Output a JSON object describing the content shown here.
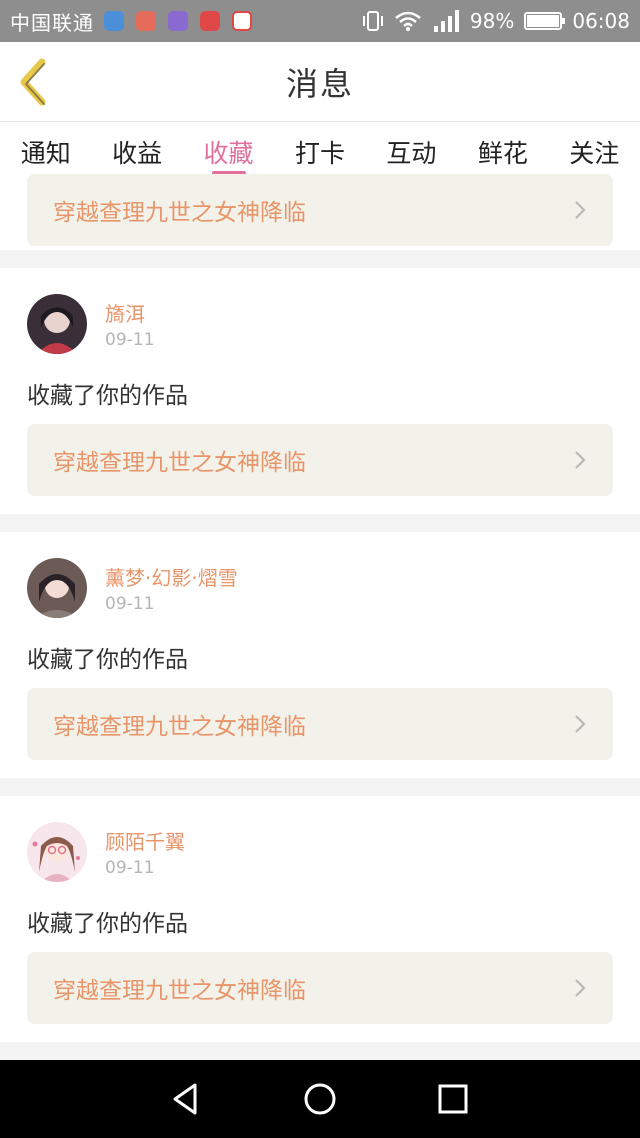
{
  "status_bar": {
    "carrier": "中国联通",
    "battery": "98%",
    "battery_level": 0.98,
    "time": "06:08",
    "app_icons": [
      {
        "name": "maps-icon",
        "color": "#4a8fd8"
      },
      {
        "name": "mail-icon",
        "color": "#e56b5a"
      },
      {
        "name": "gallery-icon",
        "color": "#8a6ad0"
      },
      {
        "name": "cloud-icon",
        "color": "#e04848"
      },
      {
        "name": "video-icon",
        "color": "#ffffff"
      }
    ]
  },
  "header": {
    "title": "消息"
  },
  "tabs": [
    {
      "label": "通知",
      "active": false
    },
    {
      "label": "收益",
      "active": false
    },
    {
      "label": "收藏",
      "active": true
    },
    {
      "label": "打卡",
      "active": false
    },
    {
      "label": "互动",
      "active": false
    },
    {
      "label": "鲜花",
      "active": false
    },
    {
      "label": "关注",
      "active": false
    }
  ],
  "colors": {
    "accent": "#e0709d",
    "username": "#e8956a",
    "work_title": "#e8956a"
  },
  "partial_item": {
    "work_title": "穿越查理九世之女神降临"
  },
  "items": [
    {
      "username": "旖洱",
      "date": "09-11",
      "action": "收藏了你的作品",
      "work_title": "穿越查理九世之女神降临"
    },
    {
      "username": "薰梦·幻影·熠雪",
      "date": "09-11",
      "action": "收藏了你的作品",
      "work_title": "穿越查理九世之女神降临"
    },
    {
      "username": "顾陌千翼",
      "date": "09-11",
      "action": "收藏了你的作品",
      "work_title": "穿越查理九世之女神降临"
    }
  ]
}
